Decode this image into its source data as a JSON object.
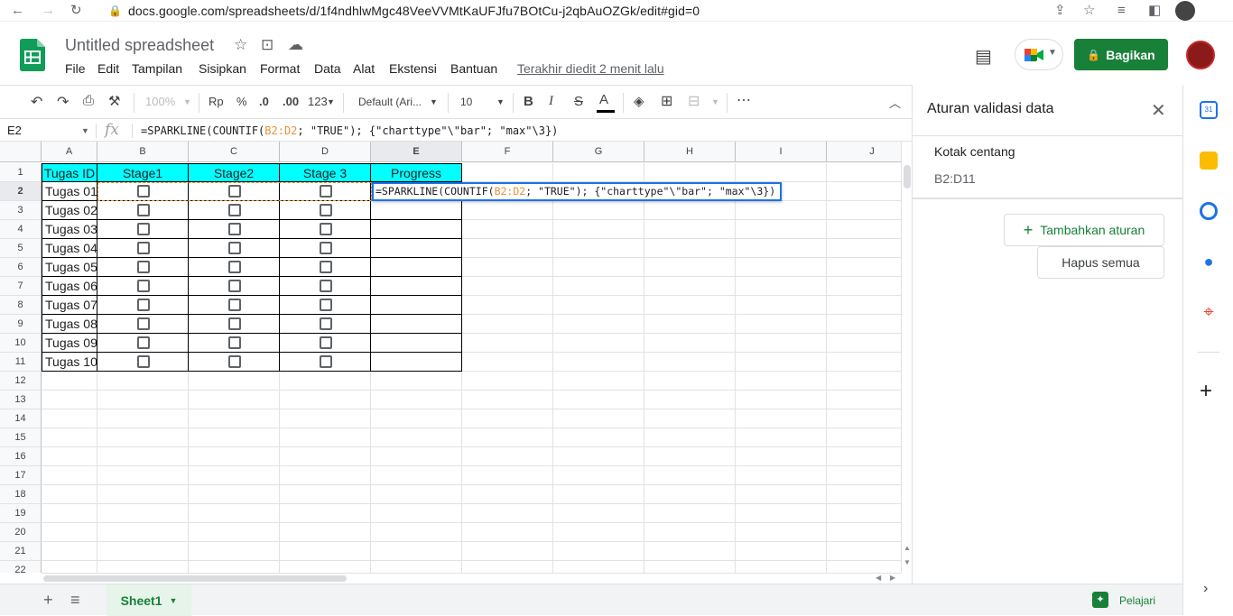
{
  "browser": {
    "url": "docs.google.com/spreadsheets/d/1f4ndhlwMgc48VeeVVMtKaUFJfu7BOtCu-j2qbAuOZGk/edit#gid=0"
  },
  "app": {
    "title": "Untitled spreadsheet",
    "menu": [
      "File",
      "Edit",
      "Tampilan",
      "Sisipkan",
      "Format",
      "Data",
      "Alat",
      "Ekstensi",
      "Bantuan"
    ],
    "last_edit": "Terakhir diedit 2 menit lalu",
    "share_label": "Bagikan"
  },
  "toolbar": {
    "zoom": "100%",
    "currency": "Rp",
    "percent": "%",
    "dec_less": ".0",
    "dec_more": ".00",
    "number_format": "123",
    "font": "Default (Ari...",
    "font_size": "10",
    "bold": "B",
    "italic": "I",
    "strike": "S",
    "text_color": "A"
  },
  "formula_bar": {
    "name_box": "E2",
    "fx": "fx",
    "formula_pre": "=SPARKLINE(COUNTIF(",
    "formula_range": "B2:D2",
    "formula_post": "; \"TRUE\"); {\"charttype\"\\\"bar\"; \"max\"\\3})"
  },
  "grid": {
    "columns": [
      "A",
      "B",
      "C",
      "D",
      "E",
      "F",
      "G",
      "H",
      "I",
      "J"
    ],
    "rows": [
      "1",
      "2",
      "3",
      "4",
      "5",
      "6",
      "7",
      "8",
      "9",
      "10",
      "11",
      "12",
      "13",
      "14",
      "15",
      "16",
      "17",
      "18",
      "19",
      "20",
      "21",
      "22"
    ],
    "header_row": [
      "Tugas ID",
      "Stage1",
      "Stage2",
      "Stage 3",
      "Progress"
    ],
    "tasks": [
      "Tugas 01",
      "Tugas 02",
      "Tugas 03",
      "Tugas 04",
      "Tugas 05",
      "Tugas 06",
      "Tugas 07",
      "Tugas 08",
      "Tugas 09",
      "Tugas 10"
    ],
    "header_color": "#00ffff"
  },
  "sheet": {
    "tab_name": "Sheet1",
    "learn_label": "Pelajari"
  },
  "panel": {
    "title": "Aturan validasi data",
    "rule_type": "Kotak centang",
    "rule_range": "B2:D11",
    "add_rule": "Tambahkan aturan",
    "delete_all": "Hapus semua"
  }
}
